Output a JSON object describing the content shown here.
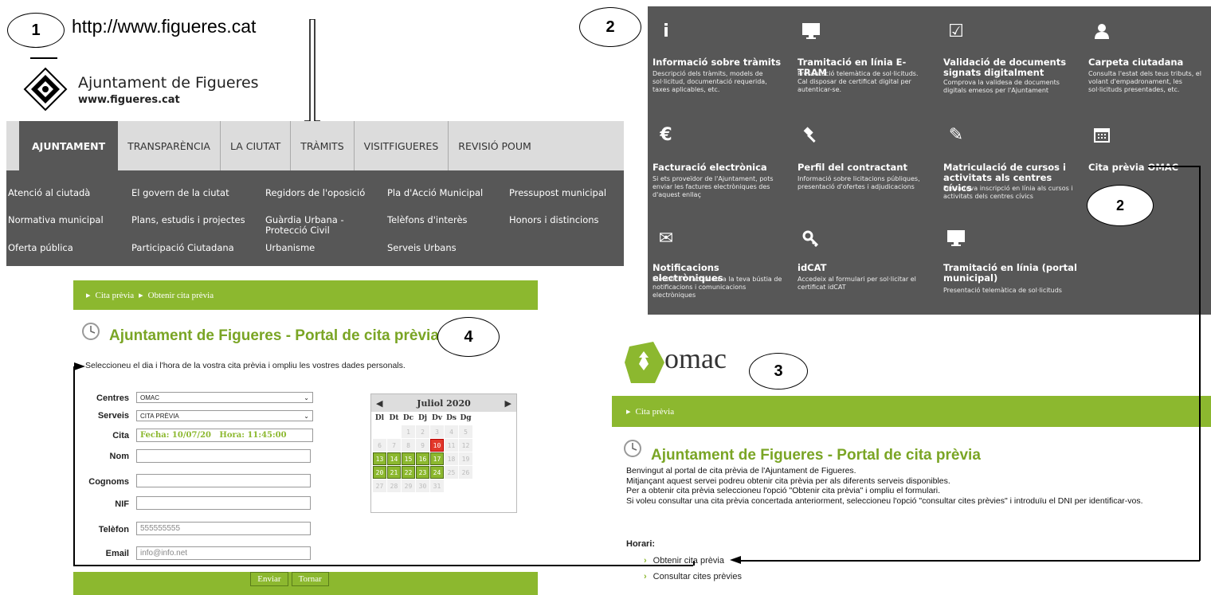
{
  "callouts": {
    "n1": "1",
    "n2": "2",
    "n2b": "2",
    "n3": "3",
    "n4": "4"
  },
  "panel1": {
    "url": "http://www.figueres.cat",
    "site_title": "Ajuntament de Figueres",
    "site_sub": "www.figueres.cat",
    "tabs": [
      "AJUNTAMENT",
      "TRANSPARÈNCIA",
      "LA CIUTAT",
      "TRÀMITS",
      "VISITFIGUERES",
      "REVISIÓ POUM"
    ],
    "submenu": [
      [
        "Atenció al ciutadà",
        "El govern de la ciutat",
        "Regidors de l'oposició",
        "Pla d'Acció Municipal",
        "Pressupost municipal"
      ],
      [
        "Normativa municipal",
        "Plans, estudis i projectes",
        "Guàrdia Urbana -\nProtecció Civil",
        "Telèfons d'interès",
        "Honors i distincions"
      ],
      [
        "Oferta pública",
        "Participació Ciutadana",
        "Urbanisme",
        "Serveis Urbans",
        ""
      ]
    ]
  },
  "panel2": {
    "tiles": [
      {
        "icon": "info-icon",
        "glyph": "i",
        "title": "Informació sobre tràmits",
        "desc": "Descripció dels tràmits, models de sol·licitud, documentació requerida, taxes aplicables, etc."
      },
      {
        "icon": "monitor-icon",
        "glyph": "",
        "title": "Tramitació en línia E-TRAM",
        "desc": "Presentació telemàtica de sol·licituds. Cal disposar de certificat digital per autenticar-se."
      },
      {
        "icon": "checkbox-icon",
        "glyph": "☑",
        "title": "Validació de documents signats digitalment",
        "desc": "Comprova la validesa de documents digitals emesos per l'Ajuntament"
      },
      {
        "icon": "user-icon",
        "glyph": "",
        "title": "Carpeta ciutadana",
        "desc": "Consulta l'estat dels teus tributs, el volant d'empadronament, les sol·licituds presentades, etc."
      },
      {
        "icon": "euro-icon",
        "glyph": "€",
        "title": "Facturació electrònica",
        "desc": "Si ets proveïdor de l'Ajuntament, pots enviar les factures electròniques des d'aquest enllaç"
      },
      {
        "icon": "gavel-icon",
        "glyph": "",
        "title": "Perfil del contractant",
        "desc": "Informació sobre licitacions públiques, presentació d'ofertes i adjudicacions"
      },
      {
        "icon": "edit-icon",
        "glyph": "✎",
        "title": "Matriculació de cursos i activitats als centres cívics",
        "desc": "Fes la teva inscripció en línia als cursos i activitats dels centres cívics"
      },
      {
        "icon": "calendar-icon",
        "glyph": "",
        "title": "Cita prèvia OMAC",
        "desc": ""
      },
      {
        "icon": "envelope-icon",
        "glyph": "✉",
        "title": "Notificacions electròniques",
        "desc": "Identifica't i accedeix a la teva bústia de notificacions i comunicacions electròniques"
      },
      {
        "icon": "key-icon",
        "glyph": "",
        "title": "idCAT",
        "desc": "Accedeix al formulari per sol·licitar el certificat idCAT"
      },
      {
        "icon": "monitor-icon",
        "glyph": "",
        "title": "Tramitació en línia (portal municipal)",
        "desc": "Presentació telemàtica de sol·licituds"
      }
    ]
  },
  "panel3": {
    "logo_text": "omac",
    "breadcrumb": "Cita prèvia",
    "title": "Ajuntament de Figueres - Portal de cita prèvia",
    "paragraphs": [
      "Benvingut al portal de cita prèvia de l'Ajuntament de Figueres.",
      "Mitjançant aquest servei podreu obtenir cita prèvia per als diferents serveis disponibles.",
      "Per a obtenir cita prèvia seleccioneu l'opció \"Obtenir cita prèvia\" i ompliu el formulari.",
      "Si voleu consultar una cita prèvia concertada anteriorment, seleccioneu l'opció \"consultar cites prèvies\" i introduïu el DNI per identificar-vos."
    ],
    "horari": "Horari:",
    "link1": "Obtenir cita prèvia",
    "link2": "Consultar cites prèvies"
  },
  "panel4": {
    "breadcrumb1": "Cita prèvia",
    "breadcrumb2": "Obtenir cita prèvia",
    "title": "Ajuntament de Figueres - Portal de cita prèvia",
    "instructions": "Seleccioneu el dia i l'hora de la vostra cita prèvia i ompliu les vostres dades personals.",
    "labels": {
      "centres": "Centres",
      "serveis": "Serveis",
      "cita": "Cita",
      "nom": "Nom",
      "cognoms": "Cognoms",
      "nif": "NIF",
      "telefon": "Telèfon",
      "email": "Email"
    },
    "centres_value": "OMAC",
    "serveis_value": "CITA PRÈVIA",
    "cita_value": "Fecha: 10/07/20   Hora: 11:45:00",
    "telefon_value": "555555555",
    "email_value": "info@info.net",
    "enviar": "Enviar",
    "tornar": "Tornar",
    "calendar": {
      "month": "Juliol 2020",
      "days": [
        "Dl",
        "Dt",
        "Dc",
        "Dj",
        "Dv",
        "Ds",
        "Dg"
      ],
      "cells": [
        [
          "",
          "",
          "1",
          "2",
          "3",
          "4",
          "5"
        ],
        [
          "6",
          "7",
          "8",
          "9",
          "10",
          "11",
          "12"
        ],
        [
          "13",
          "14",
          "15",
          "16",
          "17",
          "18",
          "19"
        ],
        [
          "20",
          "21",
          "22",
          "23",
          "24",
          "25",
          "26"
        ],
        [
          "27",
          "28",
          "29",
          "30",
          "31",
          "",
          ""
        ]
      ],
      "selected": "10",
      "available": [
        "13",
        "14",
        "15",
        "16",
        "17",
        "20",
        "21",
        "22",
        "23",
        "24"
      ]
    }
  }
}
